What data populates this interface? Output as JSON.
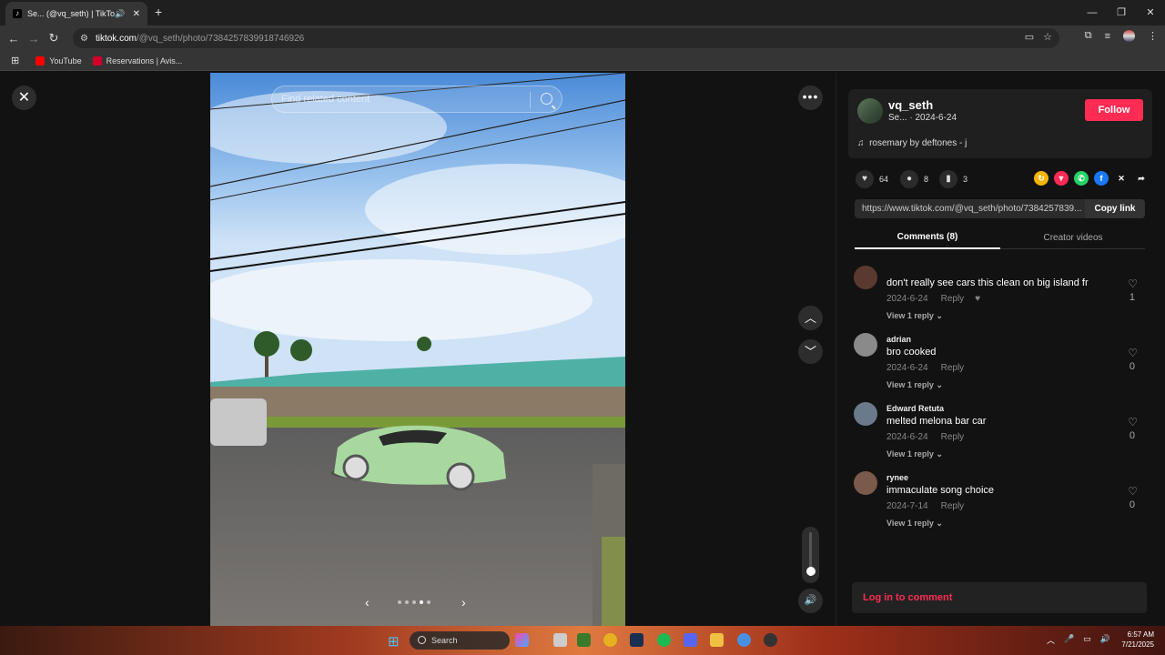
{
  "browser": {
    "tab_title": "Se... (@vq_seth) | TikTok",
    "url_host": "tiktok.com",
    "url_path": "/@vq_seth/photo/7384257839918746926",
    "bookmarks": [
      {
        "label": "YouTube",
        "color": "#ff0000"
      },
      {
        "label": "Reservations | Avis...",
        "color": "#d4002a"
      }
    ]
  },
  "viewer": {
    "search_placeholder": "Find related content",
    "volume_level": 0.1,
    "carousel_dots": 5,
    "carousel_active": 3
  },
  "post": {
    "username": "vq_seth",
    "subline": "Se... · 2024-6-24",
    "follow_label": "Follow",
    "music": "rosemary by deftones - j",
    "likes": "64",
    "comments": "8",
    "saves": "3",
    "link": "https://www.tiktok.com/@vq_seth/photo/7384257839...",
    "copy_label": "Copy link",
    "tab_comments": "Comments (8)",
    "tab_creator": "Creator videos",
    "login_label": "Log in to comment"
  },
  "comments": [
    {
      "user": "",
      "text": "don't really see cars this clean on big island fr",
      "date": "2024-6-24",
      "reply": "Reply",
      "view": "View 1 reply",
      "likes": "1",
      "color": "#5a3a30"
    },
    {
      "user": "adrian",
      "text": "bro cooked",
      "date": "2024-6-24",
      "reply": "Reply",
      "view": "View 1 reply",
      "likes": "0",
      "color": "#8a8a8a"
    },
    {
      "user": "Edward Retuta",
      "text": "melted melona bar car",
      "date": "2024-6-24",
      "reply": "Reply",
      "view": "View 1 reply",
      "likes": "0",
      "color": "#6a7a8a"
    },
    {
      "user": "rynee",
      "text": "immaculate song choice",
      "date": "2024-7-14",
      "reply": "Reply",
      "view": "View 1 reply",
      "likes": "0",
      "color": "#7a5a4a"
    }
  ],
  "taskbar": {
    "search": "Search",
    "time": "6:57 AM",
    "date": "7/21/2025"
  }
}
